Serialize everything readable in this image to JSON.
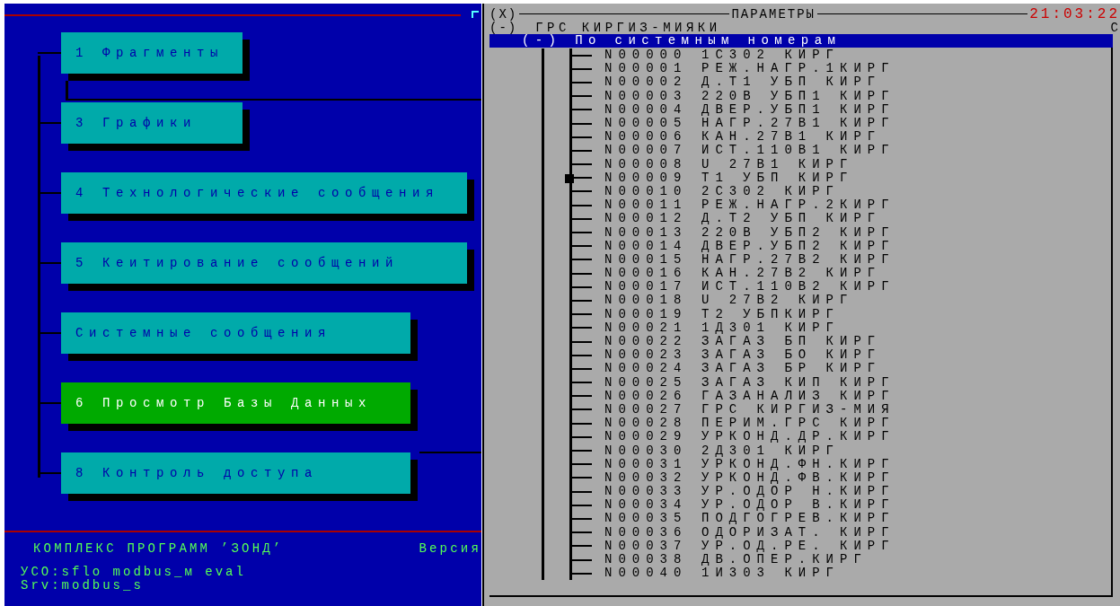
{
  "menu": [
    {
      "number": "1",
      "label": "Фрагменты",
      "selected": false
    },
    {
      "number": "3",
      "label": "Графики",
      "selected": false
    },
    {
      "number": "4",
      "label": "Технологические сообщения",
      "selected": false
    },
    {
      "number": "5",
      "label": "Кеитирование сообщений",
      "selected": false
    },
    {
      "label": "Системные сообщения",
      "selected": false
    },
    {
      "number": "6",
      "label": "Просмотр Базы Данных",
      "selected": true
    },
    {
      "number": "8",
      "label": "Контроль доступа",
      "selected": false
    }
  ],
  "footer": {
    "title": "КОМПЛЕКС ПРОГРАММ ’ЗОНД’",
    "version_label": "Версия",
    "lines": [
      "УСО:sflo modbus_м eval",
      "Srv:modbus_s"
    ]
  },
  "params": {
    "close": "(X)",
    "title": "ПАРАМЕТРЫ",
    "time": "21:03:22",
    "group": {
      "toggle": "(-)",
      "label": "ГРС КИРГИЗ-МИЯКИ",
      "edge_text": "С"
    },
    "subgroup": {
      "toggle": "(-)",
      "label": "По системным номерам"
    },
    "rows": [
      {
        "id": "N00000",
        "name": "1С302 КИРГ",
        "selected": false
      },
      {
        "id": "N00001",
        "name": "РЕЖ.НАГР.1КИРГ",
        "selected": false
      },
      {
        "id": "N00002",
        "name": "Д.Т1  УБП КИРГ",
        "selected": false
      },
      {
        "id": "N00003",
        "name": "220В УБП1 КИРГ",
        "selected": false
      },
      {
        "id": "N00004",
        "name": "ДВЕР.УБП1 КИРГ",
        "selected": false
      },
      {
        "id": "N00005",
        "name": "НАГР.27В1 КИРГ",
        "selected": false
      },
      {
        "id": "N00006",
        "name": "КАН.27В1 КИРГ",
        "selected": false
      },
      {
        "id": "N00007",
        "name": "ИСТ.110В1 КИРГ",
        "selected": false
      },
      {
        "id": "N00008",
        "name": "U 27В1 КИРГ",
        "selected": false
      },
      {
        "id": "N00009",
        "name": "Т1 УБП КИРГ",
        "selected": true
      },
      {
        "id": "N00010",
        "name": "2С302 КИРГ",
        "selected": false
      },
      {
        "id": "N00011",
        "name": "РЕЖ.НАГР.2КИРГ",
        "selected": false
      },
      {
        "id": "N00012",
        "name": "Д.Т2  УБП КИРГ",
        "selected": false
      },
      {
        "id": "N00013",
        "name": "220В УБП2 КИРГ",
        "selected": false
      },
      {
        "id": "N00014",
        "name": "ДВЕР.УБП2 КИРГ",
        "selected": false
      },
      {
        "id": "N00015",
        "name": "НАГР.27В2 КИРГ",
        "selected": false
      },
      {
        "id": "N00016",
        "name": "КАН.27В2 КИРГ",
        "selected": false
      },
      {
        "id": "N00017",
        "name": "ИСТ.110В2 КИРГ",
        "selected": false
      },
      {
        "id": "N00018",
        "name": "U 27В2 КИРГ",
        "selected": false
      },
      {
        "id": "N00019",
        "name": "Т2 УБПКИРГ",
        "selected": false
      },
      {
        "id": "N00021",
        "name": "1Д301 КИРГ",
        "selected": false
      },
      {
        "id": "N00022",
        "name": "ЗАГАЗ БП КИРГ",
        "selected": false
      },
      {
        "id": "N00023",
        "name": "ЗАГАЗ БО КИРГ",
        "selected": false
      },
      {
        "id": "N00024",
        "name": "ЗАГАЗ БР КИРГ",
        "selected": false
      },
      {
        "id": "N00025",
        "name": "ЗАГАЗ КИП КИРГ",
        "selected": false
      },
      {
        "id": "N00026",
        "name": "ГАЗАНАЛИЗ КИРГ",
        "selected": false
      },
      {
        "id": "N00027",
        "name": "ГРС КИРГИЗ-МИЯ",
        "selected": false
      },
      {
        "id": "N00028",
        "name": "ПЕРИМ.ГРС КИРГ",
        "selected": false
      },
      {
        "id": "N00029",
        "name": "УРКОНД.ДР.КИРГ",
        "selected": false
      },
      {
        "id": "N00030",
        "name": "2Д301 КИРГ",
        "selected": false
      },
      {
        "id": "N00031",
        "name": "УРКОНД.ФН.КИРГ",
        "selected": false
      },
      {
        "id": "N00032",
        "name": "УРКОНД.ФВ.КИРГ",
        "selected": false
      },
      {
        "id": "N00033",
        "name": "УР.ОДОР Н.КИРГ",
        "selected": false
      },
      {
        "id": "N00034",
        "name": "УР.ОДОР В.КИРГ",
        "selected": false
      },
      {
        "id": "N00035",
        "name": "ПОДГОГРЕВ.КИРГ",
        "selected": false
      },
      {
        "id": "N00036",
        "name": "ОДОРИЗАТ. КИРГ",
        "selected": false
      },
      {
        "id": "N00037",
        "name": "УР.ОД.РЕ. КИРГ",
        "selected": false
      },
      {
        "id": "N00038",
        "name": "ДВ.ОПЕР.КИРГ",
        "selected": false
      },
      {
        "id": "N00040",
        "name": "1И303 КИРГ",
        "selected": false
      }
    ]
  }
}
